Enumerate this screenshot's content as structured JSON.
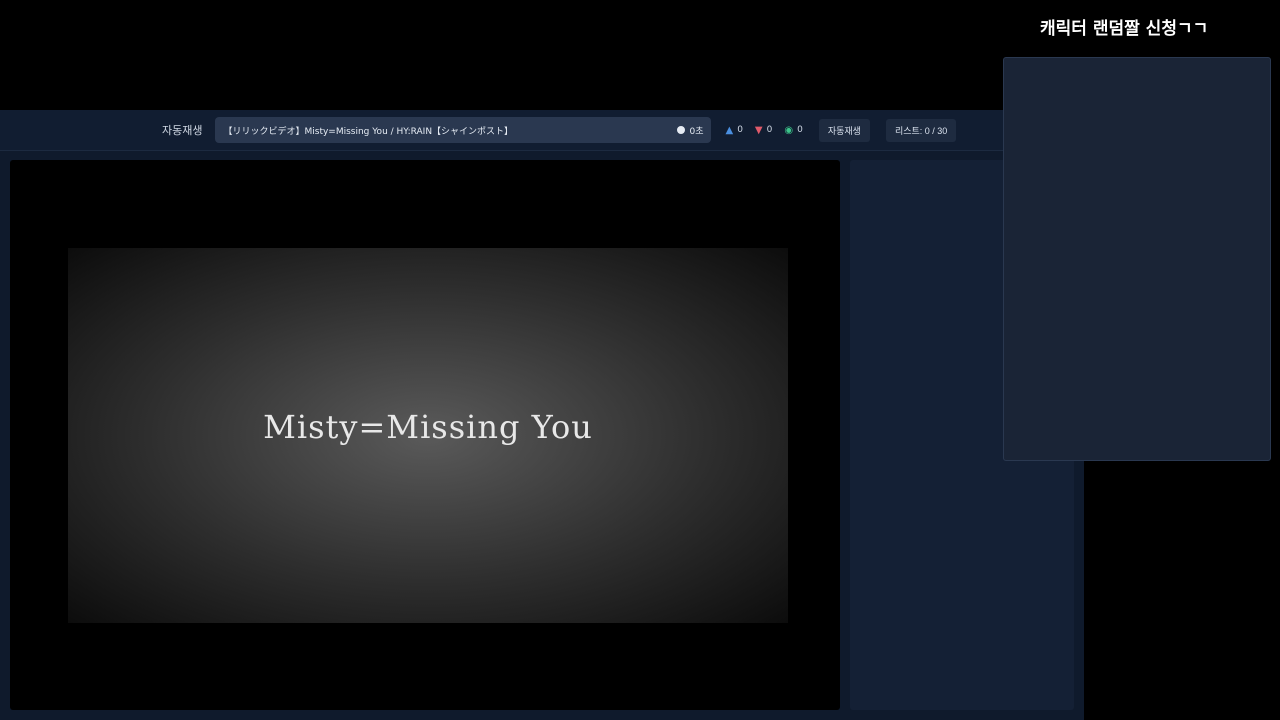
{
  "overlay": {
    "title": "캐릭터 랜덤짤 신청ㄱㄱ"
  },
  "toolbar": {
    "autoplay_label": "자동재생",
    "now_playing": "【リリックビデオ】Misty=Missing You / HY:RAIN【シャインポスト】",
    "time": "0초",
    "likes": "0",
    "dislikes": "0",
    "views": "0",
    "autoplay_button": "자동재생",
    "list_count": "리스트: 0 / 30"
  },
  "video": {
    "caption": "Misty=Missing You"
  }
}
